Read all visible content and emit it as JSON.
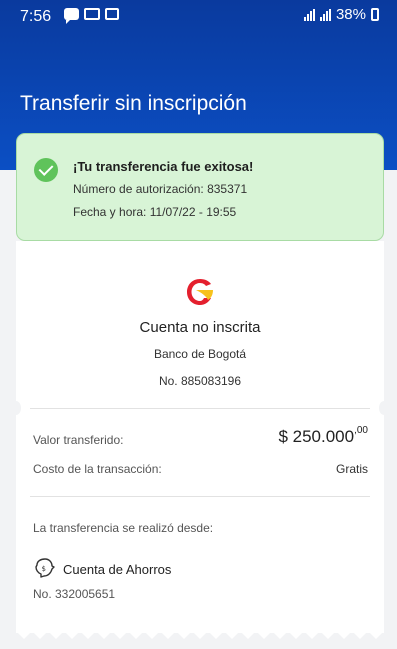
{
  "status_bar": {
    "time": "7:56",
    "battery": "38%",
    "left_icons": [
      "chat-icon",
      "mail-icon",
      "image-icon"
    ],
    "right_icons": [
      "signal-icon",
      "battery-icon"
    ]
  },
  "header": {
    "title": "Transferir sin inscripción"
  },
  "success": {
    "title": "¡Tu transferencia fue exitosa!",
    "authorization": "Número de autorización: 835371",
    "datetime": "Fecha y hora: 11/07/22 - 19:55",
    "icon": "check-icon",
    "colors": {
      "background": "#d8f4d6",
      "accent": "#5fc35b"
    }
  },
  "receipt": {
    "account_title": "Cuenta no inscrita",
    "bank_name": "Banco de Bogotá",
    "account_number": "No. 885083196",
    "amount_label": "Valor transferido:",
    "amount_main": "$ 250.000",
    "amount_cents": ",00",
    "cost_label": "Costo de la transacción:",
    "cost_value": "Gratis",
    "source_label": "La transferencia se realizó desde:",
    "source_account": "Cuenta de Ahorros",
    "source_number": "No. 332005651",
    "bank_logo_colors": {
      "red": "#e4202e",
      "yellow": "#f7c21c"
    }
  },
  "colors": {
    "header": "#0b4fc4"
  }
}
